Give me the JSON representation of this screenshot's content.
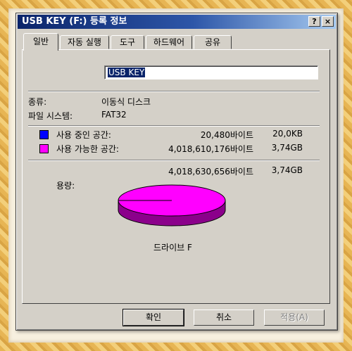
{
  "window": {
    "title": "USB KEY (F:) 등록 정보",
    "help_btn": "?",
    "close_btn": "×"
  },
  "tabs": [
    {
      "label": "일반",
      "active": true
    },
    {
      "label": "자동 실행",
      "active": false
    },
    {
      "label": "도구",
      "active": false
    },
    {
      "label": "하드웨어",
      "active": false
    },
    {
      "label": "공유",
      "active": false
    }
  ],
  "general": {
    "volume_name": "USB KEY",
    "type_label": "종류:",
    "type_value": "이동식 디스크",
    "fs_label": "파일 시스템:",
    "fs_value": "FAT32",
    "used_label": "사용 중인 공간:",
    "used_bytes": "20,480바이트",
    "used_size": "20,0KB",
    "free_label": "사용 가능한 공간:",
    "free_bytes": "4,018,610,176바이트",
    "free_size": "3,74GB",
    "capacity_label": "용량:",
    "capacity_bytes": "4,018,630,656바이트",
    "capacity_size": "3,74GB",
    "drive_label": "드라이브 F",
    "used_color": "#0000ff",
    "free_color": "#ff00ff",
    "used_fraction": 5e-06
  },
  "buttons": {
    "ok": "확인",
    "cancel": "취소",
    "apply": "적용(A)"
  }
}
